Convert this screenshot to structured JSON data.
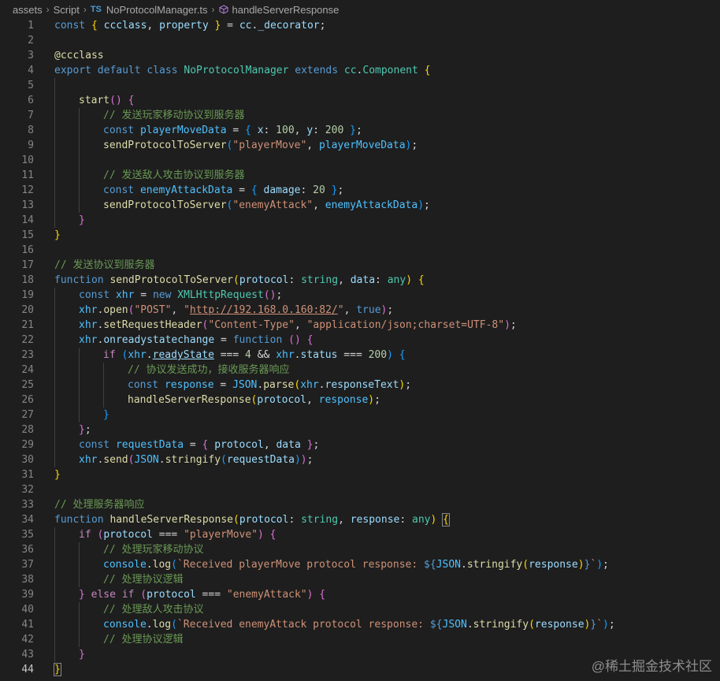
{
  "breadcrumb": {
    "items": [
      "assets",
      "Script",
      "NoProtocolManager.ts",
      "handleServerResponse"
    ],
    "file_badge": "TS"
  },
  "watermark": "@稀土掘金技术社区",
  "editor": {
    "current_line": 44,
    "lines": [
      {
        "n": "1",
        "indent": 0,
        "t": [
          [
            "kw",
            "const "
          ],
          [
            "b1",
            "{ "
          ],
          [
            "var",
            "ccclass"
          ],
          [
            "p",
            ", "
          ],
          [
            "var",
            "property"
          ],
          [
            "b1",
            " }"
          ],
          [
            "p",
            " = "
          ],
          [
            "var",
            "cc"
          ],
          [
            "p",
            "."
          ],
          [
            "var",
            "_decorator"
          ],
          [
            "p",
            ";"
          ]
        ]
      },
      {
        "n": "2",
        "indent": 0,
        "t": []
      },
      {
        "n": "3",
        "indent": 0,
        "t": [
          [
            "fn",
            "@ccclass"
          ]
        ]
      },
      {
        "n": "4",
        "indent": 0,
        "t": [
          [
            "kw",
            "export default class "
          ],
          [
            "typ",
            "NoProtocolManager "
          ],
          [
            "kw",
            "extends "
          ],
          [
            "typ",
            "cc"
          ],
          [
            "p",
            "."
          ],
          [
            "typ",
            "Component "
          ],
          [
            "b1",
            "{"
          ]
        ]
      },
      {
        "n": "5",
        "indent": 1,
        "t": []
      },
      {
        "n": "6",
        "indent": 1,
        "t": [
          [
            "fn",
            "start"
          ],
          [
            "b2",
            "()"
          ],
          [
            "p",
            " "
          ],
          [
            "b2",
            "{"
          ]
        ]
      },
      {
        "n": "7",
        "indent": 2,
        "t": [
          [
            "cmt",
            "// 发送玩家移动协议到服务器"
          ]
        ]
      },
      {
        "n": "8",
        "indent": 2,
        "t": [
          [
            "kw",
            "const "
          ],
          [
            "cst",
            "playerMoveData"
          ],
          [
            "p",
            " = "
          ],
          [
            "b3",
            "{ "
          ],
          [
            "var",
            "x"
          ],
          [
            "p",
            ": "
          ],
          [
            "num2",
            "100"
          ],
          [
            "p",
            ", "
          ],
          [
            "var",
            "y"
          ],
          [
            "p",
            ": "
          ],
          [
            "num2",
            "200"
          ],
          [
            "b3",
            " }"
          ],
          [
            "p",
            ";"
          ]
        ]
      },
      {
        "n": "9",
        "indent": 2,
        "t": [
          [
            "fn",
            "sendProtocolToServer"
          ],
          [
            "b3",
            "("
          ],
          [
            "str",
            "\"playerMove\""
          ],
          [
            "p",
            ", "
          ],
          [
            "cst",
            "playerMoveData"
          ],
          [
            "b3",
            ")"
          ],
          [
            "p",
            ";"
          ]
        ]
      },
      {
        "n": "10",
        "indent": 2,
        "t": []
      },
      {
        "n": "11",
        "indent": 2,
        "t": [
          [
            "cmt",
            "// 发送敌人攻击协议到服务器"
          ]
        ]
      },
      {
        "n": "12",
        "indent": 2,
        "t": [
          [
            "kw",
            "const "
          ],
          [
            "cst",
            "enemyAttackData"
          ],
          [
            "p",
            " = "
          ],
          [
            "b3",
            "{ "
          ],
          [
            "var",
            "damage"
          ],
          [
            "p",
            ": "
          ],
          [
            "num2",
            "20"
          ],
          [
            "b3",
            " }"
          ],
          [
            "p",
            ";"
          ]
        ]
      },
      {
        "n": "13",
        "indent": 2,
        "t": [
          [
            "fn",
            "sendProtocolToServer"
          ],
          [
            "b3",
            "("
          ],
          [
            "str",
            "\"enemyAttack\""
          ],
          [
            "p",
            ", "
          ],
          [
            "cst",
            "enemyAttackData"
          ],
          [
            "b3",
            ")"
          ],
          [
            "p",
            ";"
          ]
        ]
      },
      {
        "n": "14",
        "indent": 1,
        "t": [
          [
            "b2",
            "}"
          ]
        ]
      },
      {
        "n": "15",
        "indent": 0,
        "t": [
          [
            "b1",
            "}"
          ]
        ]
      },
      {
        "n": "16",
        "indent": 0,
        "t": []
      },
      {
        "n": "17",
        "indent": 0,
        "t": [
          [
            "cmt",
            "// 发送协议到服务器"
          ]
        ]
      },
      {
        "n": "18",
        "indent": 0,
        "t": [
          [
            "kw",
            "function "
          ],
          [
            "fn",
            "sendProtocolToServer"
          ],
          [
            "b1",
            "("
          ],
          [
            "var",
            "protocol"
          ],
          [
            "p",
            ": "
          ],
          [
            "typ",
            "string"
          ],
          [
            "p",
            ", "
          ],
          [
            "var",
            "data"
          ],
          [
            "p",
            ": "
          ],
          [
            "typ",
            "any"
          ],
          [
            "b1",
            ")"
          ],
          [
            "p",
            " "
          ],
          [
            "b1",
            "{"
          ]
        ]
      },
      {
        "n": "19",
        "indent": 1,
        "t": [
          [
            "kw",
            "const "
          ],
          [
            "cst",
            "xhr"
          ],
          [
            "p",
            " = "
          ],
          [
            "kw",
            "new "
          ],
          [
            "typ",
            "XMLHttpRequest"
          ],
          [
            "b2",
            "()"
          ],
          [
            "p",
            ";"
          ]
        ]
      },
      {
        "n": "20",
        "indent": 1,
        "t": [
          [
            "cst",
            "xhr"
          ],
          [
            "p",
            "."
          ],
          [
            "fn",
            "open"
          ],
          [
            "b2",
            "("
          ],
          [
            "str",
            "\"POST\""
          ],
          [
            "p",
            ", "
          ],
          [
            "str",
            "\""
          ],
          [
            "str und",
            "http://192.168.0.160:82/"
          ],
          [
            "str",
            "\""
          ],
          [
            "p",
            ", "
          ],
          [
            "kw",
            "true"
          ],
          [
            "b2",
            ")"
          ],
          [
            "p",
            ";"
          ]
        ]
      },
      {
        "n": "21",
        "indent": 1,
        "t": [
          [
            "cst",
            "xhr"
          ],
          [
            "p",
            "."
          ],
          [
            "fn",
            "setRequestHeader"
          ],
          [
            "b2",
            "("
          ],
          [
            "str",
            "\"Content-Type\""
          ],
          [
            "p",
            ", "
          ],
          [
            "str",
            "\"application/json;charset=UTF-8\""
          ],
          [
            "b2",
            ")"
          ],
          [
            "p",
            ";"
          ]
        ]
      },
      {
        "n": "22",
        "indent": 1,
        "t": [
          [
            "cst",
            "xhr"
          ],
          [
            "p",
            "."
          ],
          [
            "var",
            "onreadystatechange"
          ],
          [
            "p",
            " = "
          ],
          [
            "kw",
            "function"
          ],
          [
            "p",
            " "
          ],
          [
            "b2",
            "()"
          ],
          [
            "p",
            " "
          ],
          [
            "b2",
            "{"
          ]
        ]
      },
      {
        "n": "23",
        "indent": 2,
        "t": [
          [
            "ctrl",
            "if "
          ],
          [
            "b3",
            "("
          ],
          [
            "cst",
            "xhr"
          ],
          [
            "p",
            "."
          ],
          [
            "var und",
            "readyState"
          ],
          [
            "p",
            " === "
          ],
          [
            "num2",
            "4"
          ],
          [
            "p",
            " && "
          ],
          [
            "cst",
            "xhr"
          ],
          [
            "p",
            "."
          ],
          [
            "var",
            "status"
          ],
          [
            "p",
            " === "
          ],
          [
            "num2",
            "200"
          ],
          [
            "b3",
            ")"
          ],
          [
            "p",
            " "
          ],
          [
            "b3",
            "{"
          ]
        ]
      },
      {
        "n": "24",
        "indent": 3,
        "t": [
          [
            "cmt",
            "// 协议发送成功，接收服务器响应"
          ]
        ]
      },
      {
        "n": "25",
        "indent": 3,
        "t": [
          [
            "kw",
            "const "
          ],
          [
            "cst",
            "response"
          ],
          [
            "p",
            " = "
          ],
          [
            "cst",
            "JSON"
          ],
          [
            "p",
            "."
          ],
          [
            "fn",
            "parse"
          ],
          [
            "b1",
            "("
          ],
          [
            "cst",
            "xhr"
          ],
          [
            "p",
            "."
          ],
          [
            "var",
            "responseText"
          ],
          [
            "b1",
            ")"
          ],
          [
            "p",
            ";"
          ]
        ]
      },
      {
        "n": "26",
        "indent": 3,
        "t": [
          [
            "fn",
            "handleServerResponse"
          ],
          [
            "b1",
            "("
          ],
          [
            "var",
            "protocol"
          ],
          [
            "p",
            ", "
          ],
          [
            "cst",
            "response"
          ],
          [
            "b1",
            ")"
          ],
          [
            "p",
            ";"
          ]
        ]
      },
      {
        "n": "27",
        "indent": 2,
        "t": [
          [
            "b3",
            "}"
          ]
        ]
      },
      {
        "n": "28",
        "indent": 1,
        "t": [
          [
            "b2",
            "}"
          ],
          [
            "p",
            ";"
          ]
        ]
      },
      {
        "n": "29",
        "indent": 1,
        "t": [
          [
            "kw",
            "const "
          ],
          [
            "cst",
            "requestData"
          ],
          [
            "p",
            " = "
          ],
          [
            "b2",
            "{ "
          ],
          [
            "var",
            "protocol"
          ],
          [
            "p",
            ", "
          ],
          [
            "var",
            "data"
          ],
          [
            "b2",
            " }"
          ],
          [
            "p",
            ";"
          ]
        ]
      },
      {
        "n": "30",
        "indent": 1,
        "t": [
          [
            "cst",
            "xhr"
          ],
          [
            "p",
            "."
          ],
          [
            "fn",
            "send"
          ],
          [
            "b2",
            "("
          ],
          [
            "cst",
            "JSON"
          ],
          [
            "p",
            "."
          ],
          [
            "fn",
            "stringify"
          ],
          [
            "b3",
            "("
          ],
          [
            "var",
            "requestData"
          ],
          [
            "b3",
            ")"
          ],
          [
            "b2",
            ")"
          ],
          [
            "p",
            ";"
          ]
        ]
      },
      {
        "n": "31",
        "indent": 0,
        "t": [
          [
            "b1",
            "}"
          ]
        ]
      },
      {
        "n": "32",
        "indent": 0,
        "t": []
      },
      {
        "n": "33",
        "indent": 0,
        "t": [
          [
            "cmt",
            "// 处理服务器响应"
          ]
        ]
      },
      {
        "n": "34",
        "indent": 0,
        "t": [
          [
            "kw",
            "function "
          ],
          [
            "fn",
            "handleServerResponse"
          ],
          [
            "b1",
            "("
          ],
          [
            "var",
            "protocol"
          ],
          [
            "p",
            ": "
          ],
          [
            "typ",
            "string"
          ],
          [
            "p",
            ", "
          ],
          [
            "var",
            "response"
          ],
          [
            "p",
            ": "
          ],
          [
            "typ",
            "any"
          ],
          [
            "b1",
            ")"
          ],
          [
            "p",
            " "
          ],
          [
            "b1 cursorbox",
            "{"
          ]
        ]
      },
      {
        "n": "35",
        "indent": 1,
        "t": [
          [
            "ctrl",
            "if "
          ],
          [
            "b2",
            "("
          ],
          [
            "var",
            "protocol"
          ],
          [
            "p",
            " === "
          ],
          [
            "str",
            "\"playerMove\""
          ],
          [
            "b2",
            ")"
          ],
          [
            "p",
            " "
          ],
          [
            "b2",
            "{"
          ]
        ]
      },
      {
        "n": "36",
        "indent": 2,
        "t": [
          [
            "cmt",
            "// 处理玩家移动协议"
          ]
        ]
      },
      {
        "n": "37",
        "indent": 2,
        "t": [
          [
            "cst",
            "console"
          ],
          [
            "p",
            "."
          ],
          [
            "fn",
            "log"
          ],
          [
            "b3",
            "("
          ],
          [
            "str",
            "`Received playerMove protocol response: "
          ],
          [
            "kw",
            "${"
          ],
          [
            "cst",
            "JSON"
          ],
          [
            "p",
            "."
          ],
          [
            "fn",
            "stringify"
          ],
          [
            "b1",
            "("
          ],
          [
            "var",
            "response"
          ],
          [
            "b1",
            ")"
          ],
          [
            "kw",
            "}"
          ],
          [
            "str",
            "`"
          ],
          [
            "b3",
            ")"
          ],
          [
            "p",
            ";"
          ]
        ]
      },
      {
        "n": "38",
        "indent": 2,
        "t": [
          [
            "cmt",
            "// 处理协议逻辑"
          ]
        ]
      },
      {
        "n": "39",
        "indent": 1,
        "t": [
          [
            "b2",
            "}"
          ],
          [
            "p",
            " "
          ],
          [
            "ctrl",
            "else if "
          ],
          [
            "b2",
            "("
          ],
          [
            "var",
            "protocol"
          ],
          [
            "p",
            " === "
          ],
          [
            "str",
            "\"enemyAttack\""
          ],
          [
            "b2",
            ")"
          ],
          [
            "p",
            " "
          ],
          [
            "b2",
            "{"
          ]
        ]
      },
      {
        "n": "40",
        "indent": 2,
        "t": [
          [
            "cmt",
            "// 处理敌人攻击协议"
          ]
        ]
      },
      {
        "n": "41",
        "indent": 2,
        "t": [
          [
            "cst",
            "console"
          ],
          [
            "p",
            "."
          ],
          [
            "fn",
            "log"
          ],
          [
            "b3",
            "("
          ],
          [
            "str",
            "`Received enemyAttack protocol response: "
          ],
          [
            "kw",
            "${"
          ],
          [
            "cst",
            "JSON"
          ],
          [
            "p",
            "."
          ],
          [
            "fn",
            "stringify"
          ],
          [
            "b1",
            "("
          ],
          [
            "var",
            "response"
          ],
          [
            "b1",
            ")"
          ],
          [
            "kw",
            "}"
          ],
          [
            "str",
            "`"
          ],
          [
            "b3",
            ")"
          ],
          [
            "p",
            ";"
          ]
        ]
      },
      {
        "n": "42",
        "indent": 2,
        "t": [
          [
            "cmt",
            "// 处理协议逻辑"
          ]
        ]
      },
      {
        "n": "43",
        "indent": 1,
        "t": [
          [
            "b2",
            "}"
          ]
        ]
      },
      {
        "n": "44",
        "indent": 0,
        "t": [
          [
            "b1 cursorbox",
            "}"
          ]
        ]
      }
    ]
  }
}
